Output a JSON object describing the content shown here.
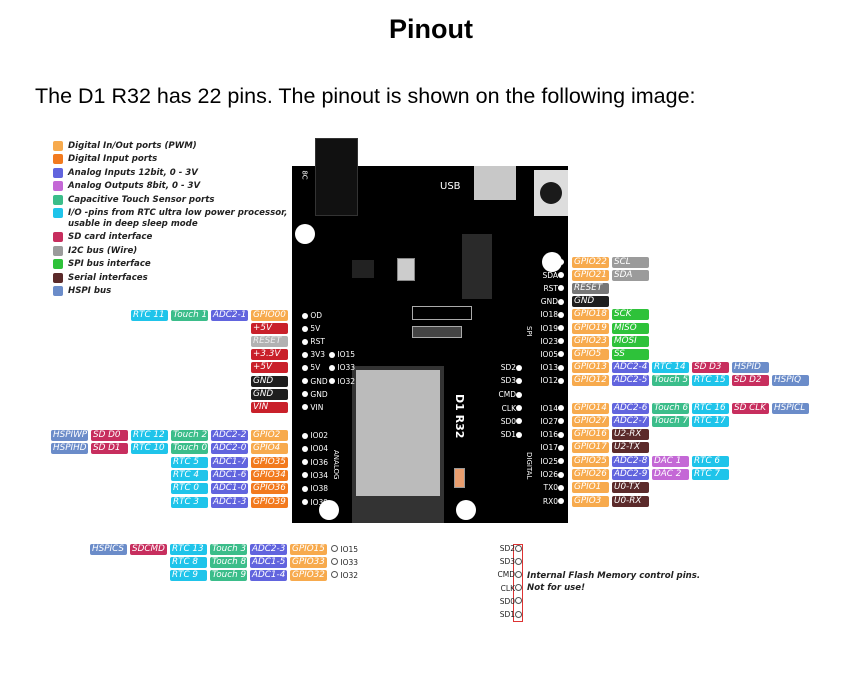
{
  "title": "Pinout",
  "intro": "The  D1 R32 has 22 pins. The pinout is shown on the following image:",
  "colors": {
    "gpio": "#f7aa4d",
    "input": "#f27a1e",
    "adc": "#6164de",
    "dac": "#c468d6",
    "touch": "#3bbd8a",
    "rtc": "#1fc4ea",
    "sd": "#c72e5e",
    "i2c": "#9b9b9b",
    "spi": "#2ec23a",
    "serial": "#5b2a2a",
    "hspi": "#6b8cc9",
    "power": "#c9202a",
    "gnd": "#1e1e1e",
    "reset": "#b2b2b2",
    "reset2": "#777777"
  },
  "legend": [
    {
      "type": "gpio",
      "text": "Digital In/Out ports (PWM)"
    },
    {
      "type": "input",
      "text": "Digital Input ports"
    },
    {
      "type": "adc",
      "text": "Analog Inputs 12bit, 0 - 3V"
    },
    {
      "type": "dac",
      "text": "Analog Outputs 8bit, 0 - 3V"
    },
    {
      "type": "touch",
      "text": "Capacitive Touch Sensor ports"
    },
    {
      "type": "rtc",
      "text": "I/O -pins from RTC ultra low power processor,",
      "text2": "usable in deep sleep mode"
    },
    {
      "type": "sd",
      "text": "SD card interface"
    },
    {
      "type": "i2c",
      "text": "I2C bus (Wire)"
    },
    {
      "type": "spi",
      "text": "SPI bus interface"
    },
    {
      "type": "serial",
      "text": "Serial interfaces"
    },
    {
      "type": "hspi",
      "text": "HSPI bus"
    }
  ],
  "board": {
    "name": "D1 R32",
    "usb": "USB",
    "jack": "8C",
    "analog": "ANALOG",
    "digital": "DIGITAL",
    "spi": "SPI"
  },
  "left_power": [
    {
      "pin": "OD",
      "tags": [
        [
          "GPIO00",
          "gpio"
        ],
        [
          "ADC2-1",
          "adc"
        ],
        [
          "Touch 1",
          "touch"
        ],
        [
          "RTC 11",
          "rtc"
        ]
      ]
    },
    {
      "pin": "5V",
      "tags": [
        [
          "+5V",
          "power"
        ]
      ]
    },
    {
      "pin": "RST",
      "tags": [
        [
          "RESET",
          "reset"
        ]
      ]
    },
    {
      "pin": "3V3",
      "inner": "IO15",
      "tags": [
        [
          "+3.3V",
          "power"
        ]
      ]
    },
    {
      "pin": "5V",
      "inner": "IO33",
      "tags": [
        [
          "+5V",
          "power"
        ]
      ]
    },
    {
      "pin": "GND",
      "inner": "IO32",
      "tags": [
        [
          "GND",
          "gnd"
        ]
      ]
    },
    {
      "pin": "GND",
      "tags": [
        [
          "GND",
          "gnd"
        ]
      ]
    },
    {
      "pin": "VIN",
      "tags": [
        [
          "VIN",
          "power"
        ]
      ]
    }
  ],
  "left_analog": [
    {
      "pin": "IO02",
      "tags": [
        [
          "GPIO2",
          "gpio"
        ],
        [
          "ADC2-2",
          "adc"
        ],
        [
          "Touch 2",
          "touch"
        ],
        [
          "RTC 12",
          "rtc"
        ],
        [
          "SD D0",
          "sd"
        ],
        [
          "HSPIWP",
          "hspi"
        ]
      ]
    },
    {
      "pin": "IO04",
      "tags": [
        [
          "GPIO4",
          "gpio"
        ],
        [
          "ADC2-0",
          "adc"
        ],
        [
          "Touch 0",
          "touch"
        ],
        [
          "RTC 10",
          "rtc"
        ],
        [
          "SD D1",
          "sd"
        ],
        [
          "HSPIHD",
          "hspi"
        ]
      ]
    },
    {
      "pin": "IO36",
      "tags": [
        [
          "GPIO35",
          "input"
        ],
        [
          "ADC1-7",
          "adc"
        ],
        [
          "RTC 5",
          "rtc"
        ]
      ]
    },
    {
      "pin": "IO34",
      "tags": [
        [
          "GPIO34",
          "input"
        ],
        [
          "ADC1-6",
          "adc"
        ],
        [
          "RTC 4",
          "rtc"
        ]
      ]
    },
    {
      "pin": "IO38",
      "tags": [
        [
          "GPIO36",
          "input"
        ],
        [
          "ADC1-0",
          "adc"
        ],
        [
          "RTC 0",
          "rtc"
        ]
      ]
    },
    {
      "pin": "IO39",
      "tags": [
        [
          "GPIO39",
          "input"
        ],
        [
          "ADC1-3",
          "adc"
        ],
        [
          "RTC 3",
          "rtc"
        ]
      ]
    }
  ],
  "right_top": [
    {
      "pin": "SCL",
      "tags": [
        [
          "GPIO22",
          "gpio"
        ],
        [
          "SCL",
          "i2c"
        ]
      ]
    },
    {
      "pin": "SDA",
      "tags": [
        [
          "GPIO21",
          "gpio"
        ],
        [
          "SDA",
          "i2c"
        ]
      ]
    },
    {
      "pin": "RST",
      "tags": [
        [
          "RESET",
          "reset2"
        ]
      ]
    },
    {
      "pin": "GND",
      "tags": [
        [
          "GND",
          "gnd"
        ]
      ]
    },
    {
      "pin": "IO18",
      "tags": [
        [
          "GPIO18",
          "gpio"
        ],
        [
          "SCK",
          "spi"
        ]
      ]
    },
    {
      "pin": "IO19",
      "tags": [
        [
          "GPIO19",
          "gpio"
        ],
        [
          "MISO",
          "spi"
        ]
      ]
    },
    {
      "pin": "IO23",
      "tags": [
        [
          "GPIO23",
          "gpio"
        ],
        [
          "MOSI",
          "spi"
        ]
      ]
    },
    {
      "pin": "IO05",
      "tags": [
        [
          "GPIO5",
          "gpio"
        ],
        [
          "SS",
          "spi"
        ]
      ]
    },
    {
      "pin": "IO13",
      "inner": "SD2",
      "tags": [
        [
          "GPIO13",
          "gpio"
        ],
        [
          "ADC2-4",
          "adc"
        ],
        [
          "RTC 14",
          "rtc"
        ],
        [
          "SD D3",
          "sd"
        ],
        [
          "HSPID",
          "hspi"
        ]
      ]
    },
    {
      "pin": "IO12",
      "inner": "SD3",
      "tags": [
        [
          "GPIO12",
          "gpio"
        ],
        [
          "ADC2-5",
          "adc"
        ],
        [
          "Touch 5",
          "touch"
        ],
        [
          "RTC 15",
          "rtc"
        ],
        [
          "SD D2",
          "sd"
        ],
        [
          "HSPIQ",
          "hspi"
        ]
      ]
    }
  ],
  "inner_cmd": "CMD",
  "right_bottom": [
    {
      "pin": "IO14",
      "inner": "CLK",
      "tags": [
        [
          "GPIO14",
          "gpio"
        ],
        [
          "ADC2-6",
          "adc"
        ],
        [
          "Touch 6",
          "touch"
        ],
        [
          "RTC 16",
          "rtc"
        ],
        [
          "SD CLK",
          "sd"
        ],
        [
          "HSPICL",
          "hspi"
        ]
      ]
    },
    {
      "pin": "IO27",
      "inner": "SD0",
      "tags": [
        [
          "GPIO27",
          "gpio"
        ],
        [
          "ADC2-7",
          "adc"
        ],
        [
          "Touch 7",
          "touch"
        ],
        [
          "RTC 17",
          "rtc"
        ]
      ]
    },
    {
      "pin": "IO16",
      "inner": "SD1",
      "tags": [
        [
          "GPIO16",
          "gpio"
        ],
        [
          "U2-RX",
          "serial"
        ]
      ]
    },
    {
      "pin": "IO17",
      "tags": [
        [
          "GPIO17",
          "gpio"
        ],
        [
          "U2-TX",
          "serial"
        ]
      ]
    },
    {
      "pin": "IO25",
      "tags": [
        [
          "GPIO25",
          "gpio"
        ],
        [
          "ADC2-8",
          "adc"
        ],
        [
          "DAC 1",
          "dac"
        ],
        [
          "RTC 6",
          "rtc"
        ]
      ]
    },
    {
      "pin": "IO26",
      "tags": [
        [
          "GPIO26",
          "gpio"
        ],
        [
          "ADC2-9",
          "adc"
        ],
        [
          "DAC 2",
          "dac"
        ],
        [
          "RTC 7",
          "rtc"
        ]
      ]
    },
    {
      "pin": "TX0",
      "tags": [
        [
          "GPIO1",
          "gpio"
        ],
        [
          "U0-TX",
          "serial"
        ]
      ]
    },
    {
      "pin": "RX0",
      "tags": [
        [
          "GPIO3",
          "gpio"
        ],
        [
          "U0-RX",
          "serial"
        ]
      ]
    }
  ],
  "bottom_left": [
    {
      "pin": "IO15",
      "tags": [
        [
          "GPIO15",
          "gpio"
        ],
        [
          "ADC2-3",
          "adc"
        ],
        [
          "Touch 3",
          "touch"
        ],
        [
          "RTC 13",
          "rtc"
        ],
        [
          "SDCMD",
          "sd"
        ],
        [
          "HSPICS",
          "hspi"
        ]
      ]
    },
    {
      "pin": "IO33",
      "tags": [
        [
          "GPIO33",
          "gpio"
        ],
        [
          "ADC1-5",
          "adc"
        ],
        [
          "Touch 8",
          "touch"
        ],
        [
          "RTC 8",
          "rtc"
        ]
      ]
    },
    {
      "pin": "IO32",
      "tags": [
        [
          "GPIO32",
          "gpio"
        ],
        [
          "ADC1-4",
          "adc"
        ],
        [
          "Touch 9",
          "touch"
        ],
        [
          "RTC 9",
          "rtc"
        ]
      ]
    }
  ],
  "flash": {
    "pins": [
      "SD2",
      "SD3",
      "CMD",
      "CLK",
      "SD0",
      "SD1"
    ],
    "note1": "Internal Flash Memory control pins.",
    "note2": "Not for use!"
  }
}
